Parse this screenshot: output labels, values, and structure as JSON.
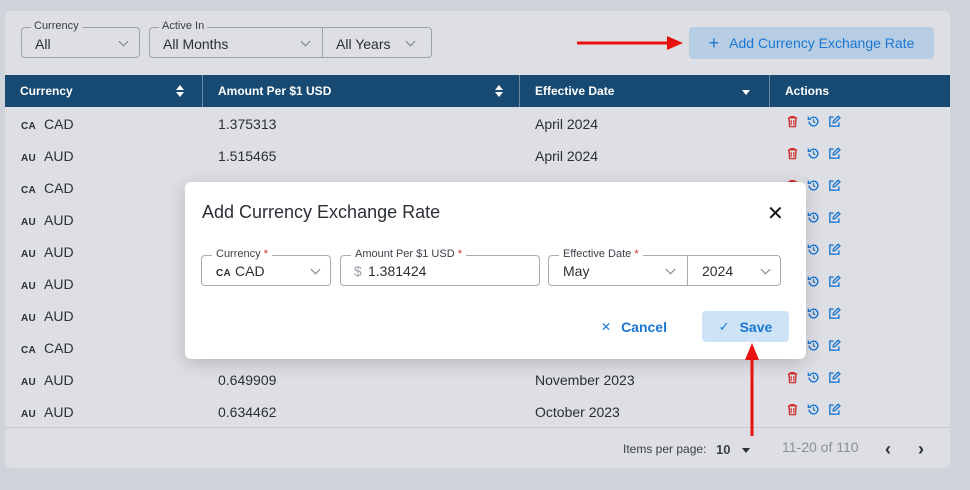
{
  "filters": {
    "currency": {
      "label": "Currency",
      "value": "All"
    },
    "active_in": {
      "label": "Active In",
      "month_value": "All Months",
      "year_value": "All Years"
    }
  },
  "add_button_label": "Add Currency Exchange Rate",
  "table": {
    "headers": [
      "Currency",
      "Amount Per $1 USD",
      "Effective Date",
      "Actions"
    ],
    "rows": [
      {
        "code": "CA",
        "currency": "CAD",
        "amount": "1.375313",
        "date": "April 2024"
      },
      {
        "code": "AU",
        "currency": "AUD",
        "amount": "1.515465",
        "date": "April 2024"
      },
      {
        "code": "CA",
        "currency": "CAD",
        "amount": "",
        "date": ""
      },
      {
        "code": "AU",
        "currency": "AUD",
        "amount": "",
        "date": ""
      },
      {
        "code": "AU",
        "currency": "AUD",
        "amount": "",
        "date": ""
      },
      {
        "code": "AU",
        "currency": "AUD",
        "amount": "",
        "date": ""
      },
      {
        "code": "AU",
        "currency": "AUD",
        "amount": "",
        "date": ""
      },
      {
        "code": "CA",
        "currency": "CAD",
        "amount": "",
        "date": ""
      },
      {
        "code": "AU",
        "currency": "AUD",
        "amount": "0.649909",
        "date": "November 2023"
      },
      {
        "code": "AU",
        "currency": "AUD",
        "amount": "0.634462",
        "date": "October 2023"
      }
    ]
  },
  "pagination": {
    "items_per_page_label": "Items per page:",
    "items_per_page": "10",
    "range": "11-20 of 110"
  },
  "modal": {
    "title": "Add Currency Exchange Rate",
    "currency_label": "Currency",
    "currency_code": "CA",
    "currency_value": "CAD",
    "amount_label": "Amount Per $1 USD",
    "amount_prefix": "$",
    "amount_value": "1.381424",
    "date_label": "Effective Date",
    "month_value": "May",
    "year_value": "2024",
    "required_mark": "*",
    "cancel_label": "Cancel",
    "save_label": "Save"
  },
  "colors": {
    "accent": "#1a77d2",
    "header_bg": "#174a72",
    "delete": "#d32f2f",
    "annotation_arrow": "#e8120c"
  }
}
